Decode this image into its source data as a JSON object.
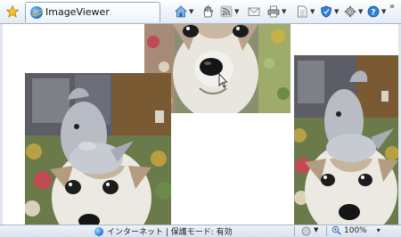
{
  "window": {
    "tab_title": "ImageViewer"
  },
  "toolbar": {
    "icons": [
      "home-icon",
      "hand-icon",
      "rss-icon",
      "mail-icon",
      "print-icon",
      "page-icon",
      "safety-icon",
      "tools-icon",
      "help-icon"
    ],
    "overflow": "»"
  },
  "content": {
    "photos": [
      {
        "subject": "dog-face-closeup"
      },
      {
        "subject": "dog-with-plush-dolphin"
      },
      {
        "subject": "dog-with-plush-dolphin"
      }
    ]
  },
  "statusbar": {
    "zone_text": "インターネット | 保護モード: 有効",
    "zoom_text": "100%",
    "zoom_dropdown": "▾"
  },
  "colors": {
    "chrome_top": "#fdfeff",
    "chrome_bottom": "#e3ebf5",
    "accent_blue": "#1f6fd1"
  }
}
